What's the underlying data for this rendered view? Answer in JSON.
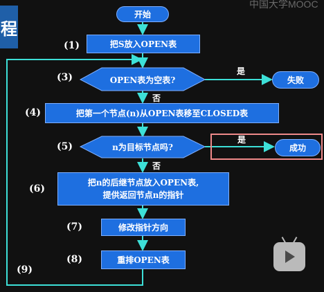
{
  "header": {
    "title_char": "程",
    "watermark": "中国大学MOOC"
  },
  "flowchart": {
    "start": "开始",
    "step1": {
      "num": "(1)",
      "text": "把S放入OPEN表"
    },
    "step3": {
      "num": "(3)",
      "text": "OPEN表为空表?"
    },
    "yes1": "是",
    "fail": "失败",
    "no1": "否",
    "step4": {
      "num": "(4)",
      "text": "把第一个节点(n)从OPEN表移至CLOSED表"
    },
    "step5": {
      "num": "(5)",
      "text": "n为目标节点吗?"
    },
    "yes2": "是",
    "success": "成功",
    "no2": "否",
    "step6": {
      "num": "(6)",
      "line1": "把n的后继节点放入OPEN表,",
      "line2": "提供返回节点n的指针"
    },
    "step7": {
      "num": "(7)",
      "text": "修改指针方向"
    },
    "step8": {
      "num": "(8)",
      "text": "重排OPEN表"
    },
    "step9": {
      "num": "(9)"
    }
  },
  "colors": {
    "box": "#1e6fe0",
    "arrow": "#3de0d8",
    "highlight": "#f08a8a",
    "background": "#111111"
  },
  "icons": {
    "tv": "tv-play-icon"
  }
}
